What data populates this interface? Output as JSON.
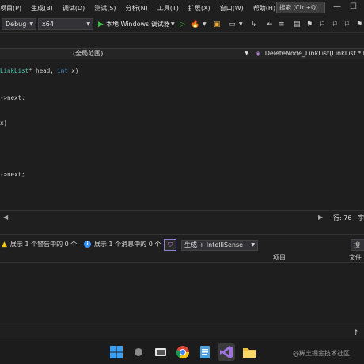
{
  "menu": {
    "items": [
      "项目(P)",
      "生成(B)",
      "调试(D)",
      "测试(S)",
      "分析(N)",
      "工具(T)",
      "扩展(X)",
      "窗口(W)",
      "帮助(H)"
    ],
    "search_text": "搜索 (Ctrl+Q)"
  },
  "toolbar": {
    "config": "Debug",
    "platform": "x64",
    "run_label": "本地 Windows 调试器"
  },
  "editor_nav": {
    "scope": "(全局范围)",
    "function": "DeleteNode_LinkList(LinkList * hea"
  },
  "code": {
    "line1_type": "LinkList",
    "line1_a": "* head, ",
    "line1_kw": "int",
    "line1_b": " x)",
    "line2": "->next;",
    "line3": "x)",
    "line4": "->next;"
  },
  "status": {
    "line_indicator": "行: 76",
    "trailing": "字"
  },
  "error_list": {
    "warnings": "展示 1 个警告中的 0 个",
    "messages": "展示 1 个消息中的 0 个",
    "build_filter": "生成 + IntelliSense",
    "search": "搜"
  },
  "columns": {
    "project": "项目",
    "file": "文件"
  },
  "watermark": "@稀土掘金技术社区"
}
